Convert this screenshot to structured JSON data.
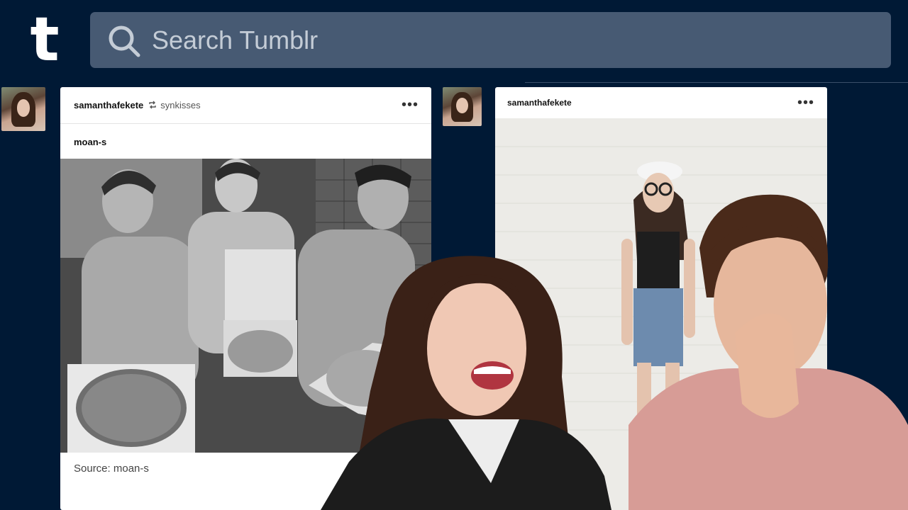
{
  "app": {
    "logo_letter": "t",
    "search_placeholder": "Search Tumblr"
  },
  "post1": {
    "username": "samanthafekete",
    "reblogged_from": "synkisses",
    "more_label": "•••",
    "source_blog": "moan-s",
    "source_caption": "Source: moan-s"
  },
  "post2": {
    "username": "samanthafekete",
    "more_label": "•••"
  },
  "icons": {
    "logo": "tumblr-logo",
    "search": "search-icon",
    "reblog": "reblog-icon",
    "more": "more-options-icon"
  },
  "colors": {
    "background": "#001935",
    "search_bar": "#475a73",
    "card": "#ffffff"
  }
}
